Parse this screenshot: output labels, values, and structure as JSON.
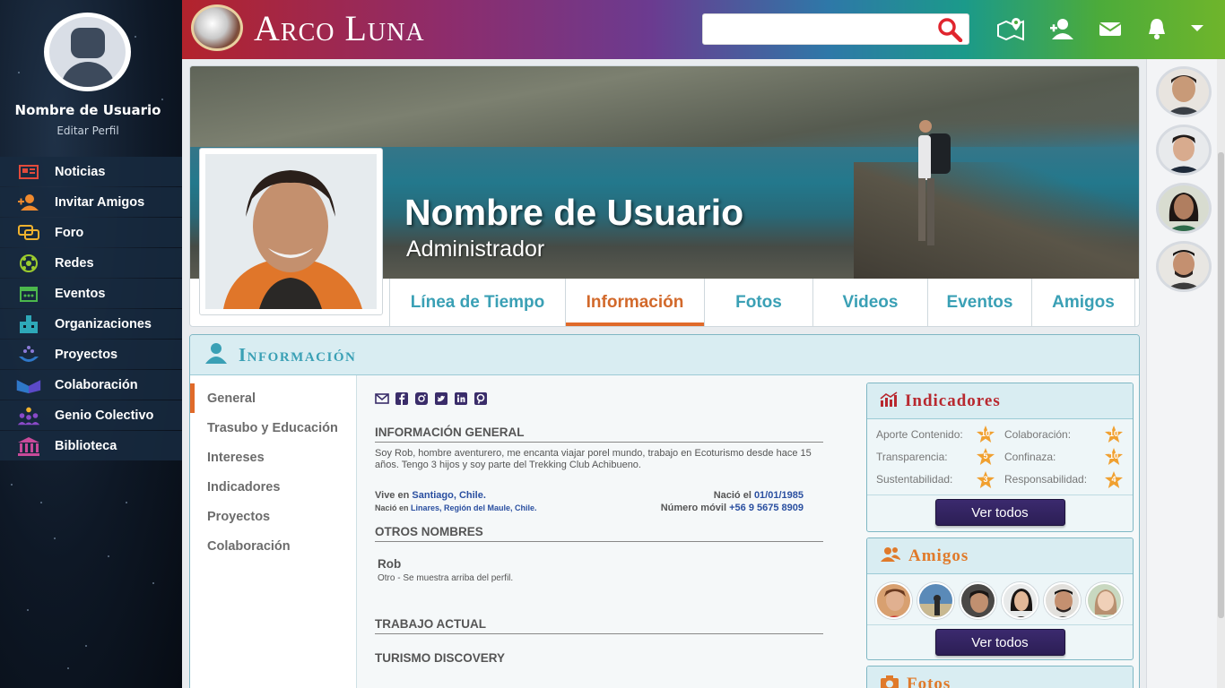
{
  "app": {
    "logo_text": "Arco Luna",
    "search_placeholder": ""
  },
  "sidebar": {
    "user_name": "Nombre de Usuario",
    "edit_profile": "Editar Perfil",
    "items": [
      {
        "label": "Noticias",
        "icon": "newspaper-icon",
        "color": "#e24a3b"
      },
      {
        "label": "Invitar Amigos",
        "icon": "invite-friends-icon",
        "color": "#f08a2e"
      },
      {
        "label": "Foro",
        "icon": "forum-icon",
        "color": "#f0b22e"
      },
      {
        "label": "Redes",
        "icon": "network-icon",
        "color": "#9ccc2e"
      },
      {
        "label": "Eventos",
        "icon": "calendar-icon",
        "color": "#4cb84c"
      },
      {
        "label": "Organizaciones",
        "icon": "organization-icon",
        "color": "#2ea8b8"
      },
      {
        "label": "Proyectos",
        "icon": "projects-icon",
        "color": "#2e78c8"
      },
      {
        "label": "Colaboración",
        "icon": "collaboration-icon",
        "color": "#5b4ac8"
      },
      {
        "label": "Genio Colectivo",
        "icon": "collective-genius-icon",
        "color": "#8a4ac8"
      },
      {
        "label": "Biblioteca",
        "icon": "library-icon",
        "color": "#c84a9a"
      }
    ]
  },
  "profile": {
    "name": "Nombre de Usuario",
    "role": "Administrador"
  },
  "tabs": [
    {
      "label": "Línea de Tiempo",
      "active": false
    },
    {
      "label": "Información",
      "active": true
    },
    {
      "label": "Fotos",
      "active": false
    },
    {
      "label": "Videos",
      "active": false
    },
    {
      "label": "Eventos",
      "active": false
    },
    {
      "label": "Amigos",
      "active": false
    }
  ],
  "info": {
    "title": "Información",
    "subnav": [
      "General",
      "Trasubo y Educación",
      "Intereses",
      "Indicadores",
      "Proyectos",
      "Colaboración"
    ],
    "general_title": "INFORMACIÓN GENERAL",
    "bio": "Soy Rob, hombre aventurero, me encanta viajar porel mundo, trabajo en Ecoturismo desde hace 15 años. Tengo 3 hijos y soy parte del Trekking Club Achibueno.",
    "lives_in_label": "Vive en",
    "lives_in_value": "Santiago, Chile.",
    "born_in_label": "Nació en",
    "born_in_value": "Linares, Región del Maule, Chile.",
    "birth_label": "Nació el",
    "birth_value": "01/01/1985",
    "mobile_label": "Número móvil",
    "mobile_value": "+56 9 5675 8909",
    "other_names_title": "OTROS NOMBRES",
    "other_name": "Rob",
    "other_name_note": "Otro - Se muestra arriba del perfil.",
    "current_job_title": "TRABAJO ACTUAL",
    "current_job": "TURISMO DISCOVERY"
  },
  "indicators": {
    "title": "Indicadores",
    "items": [
      {
        "label": "Aporte Contenido:",
        "value": "10"
      },
      {
        "label": "Colaboración:",
        "value": "10"
      },
      {
        "label": "Transparencia:",
        "value": "5"
      },
      {
        "label": "Confinaza:",
        "value": "10"
      },
      {
        "label": "Sustentabilidad:",
        "value": "3"
      },
      {
        "label": "Responsabilidad:",
        "value": "4"
      }
    ],
    "button": "Ver todos"
  },
  "friends": {
    "title": "Amigos",
    "button": "Ver todos"
  },
  "photos": {
    "title": "Fotos"
  },
  "colors": {
    "accent_teal": "#3aa0b5",
    "accent_orange": "#e06a2a",
    "indicators_red": "#b8282f",
    "friends_orange": "#e07a2a",
    "button_purple": "#2c1e55",
    "star_orange": "#f0a030"
  }
}
